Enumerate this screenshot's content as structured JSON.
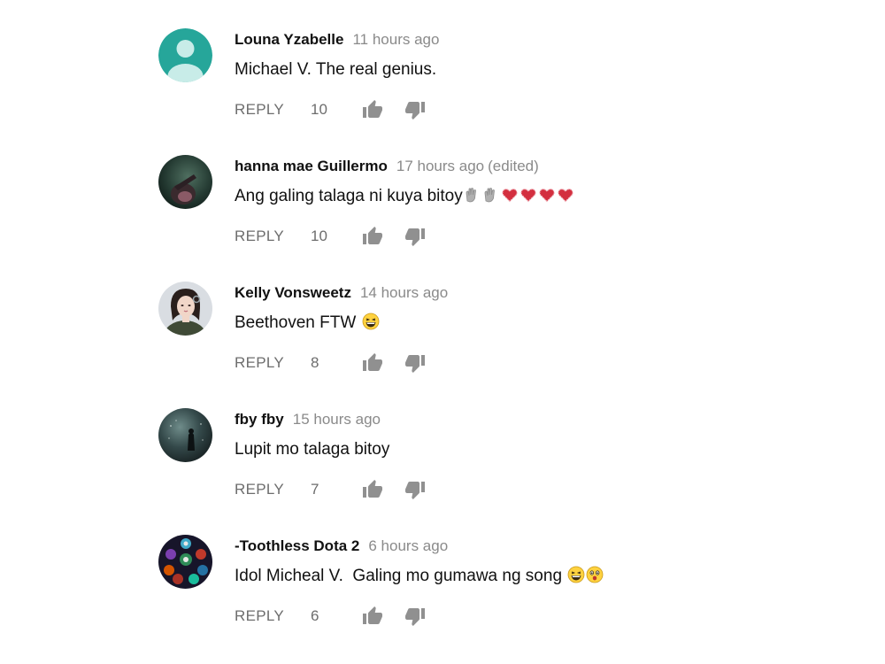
{
  "comments": [
    {
      "author": "Louna Yzabelle",
      "time": "11 hours ago",
      "edited": "",
      "text": "Michael V. The real genius.",
      "reply_label": "REPLY",
      "likes": "10"
    },
    {
      "author": "hanna mae Guillermo",
      "time": "17 hours ago",
      "edited": "(edited)",
      "text": "Ang galing talaga ni kuya bitoy",
      "reply_label": "REPLY",
      "likes": "10"
    },
    {
      "author": "Kelly Vonsweetz",
      "time": "14 hours ago",
      "edited": "",
      "text": "Beethoven FTW",
      "reply_label": "REPLY",
      "likes": "8"
    },
    {
      "author": "fby fby",
      "time": "15 hours ago",
      "edited": "",
      "text": "Lupit mo talaga bitoy",
      "reply_label": "REPLY",
      "likes": "7"
    },
    {
      "author": "-Toothless Dota 2",
      "time": "6 hours ago",
      "edited": "",
      "text": "Idol Micheal V.  Galing mo gumawa ng song",
      "reply_label": "REPLY",
      "likes": "6"
    }
  ],
  "icons": {
    "like": "thumbs-up-icon",
    "dislike": "thumbs-down-icon",
    "clap": "clapping-hands-emoji",
    "heart": "heart-emoji",
    "laugh": "grinning-squinting-emoji",
    "surprised": "surprised-face-emoji"
  },
  "colors": {
    "author": "#111111",
    "meta": "#8a8a8a",
    "action": "#6d6d6d",
    "icon": "#909090",
    "default_avatar": "#26a69a"
  }
}
